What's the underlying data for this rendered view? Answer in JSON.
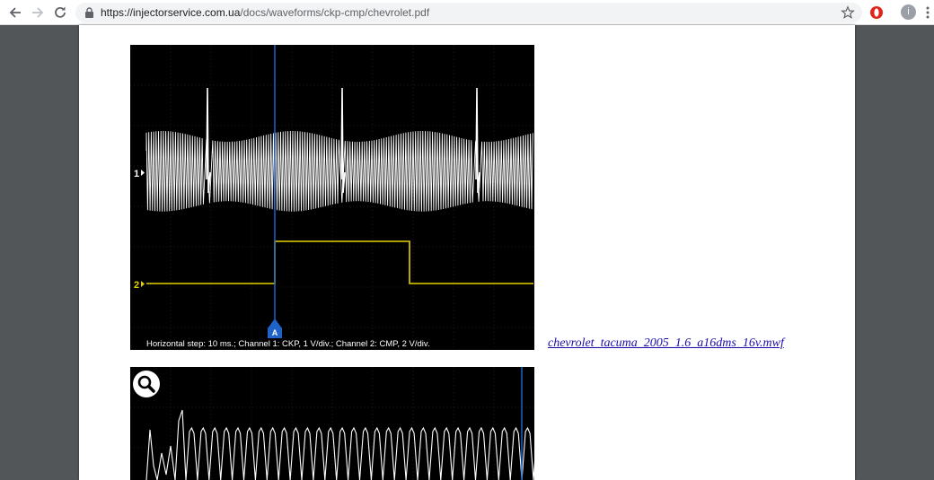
{
  "browser": {
    "url_host": "https://injectorservice.com.ua",
    "url_path": "/docs/waveforms/ckp-cmp/chevrolet.pdf",
    "avatar_initial": "i"
  },
  "figure1": {
    "channel1_marker": "1",
    "channel2_marker": "2",
    "cursor_label": "A",
    "caption": "Horizontal step: 10 ms.; Channel 1: CKP, 1 V/div.; Channel 2: CMP, 2 V/div.",
    "colors": {
      "background": "#000000",
      "grid": "#3a3a3a",
      "ch1": "#ffffff",
      "ch2": "#e6d200",
      "cursor": "#1f63c8"
    }
  },
  "attachment": {
    "file_link": "chevrolet_tacuma_2005_1.6_a16dms_16v.mwf"
  },
  "figure2": {
    "zoom_icon": "magnifier-icon"
  }
}
